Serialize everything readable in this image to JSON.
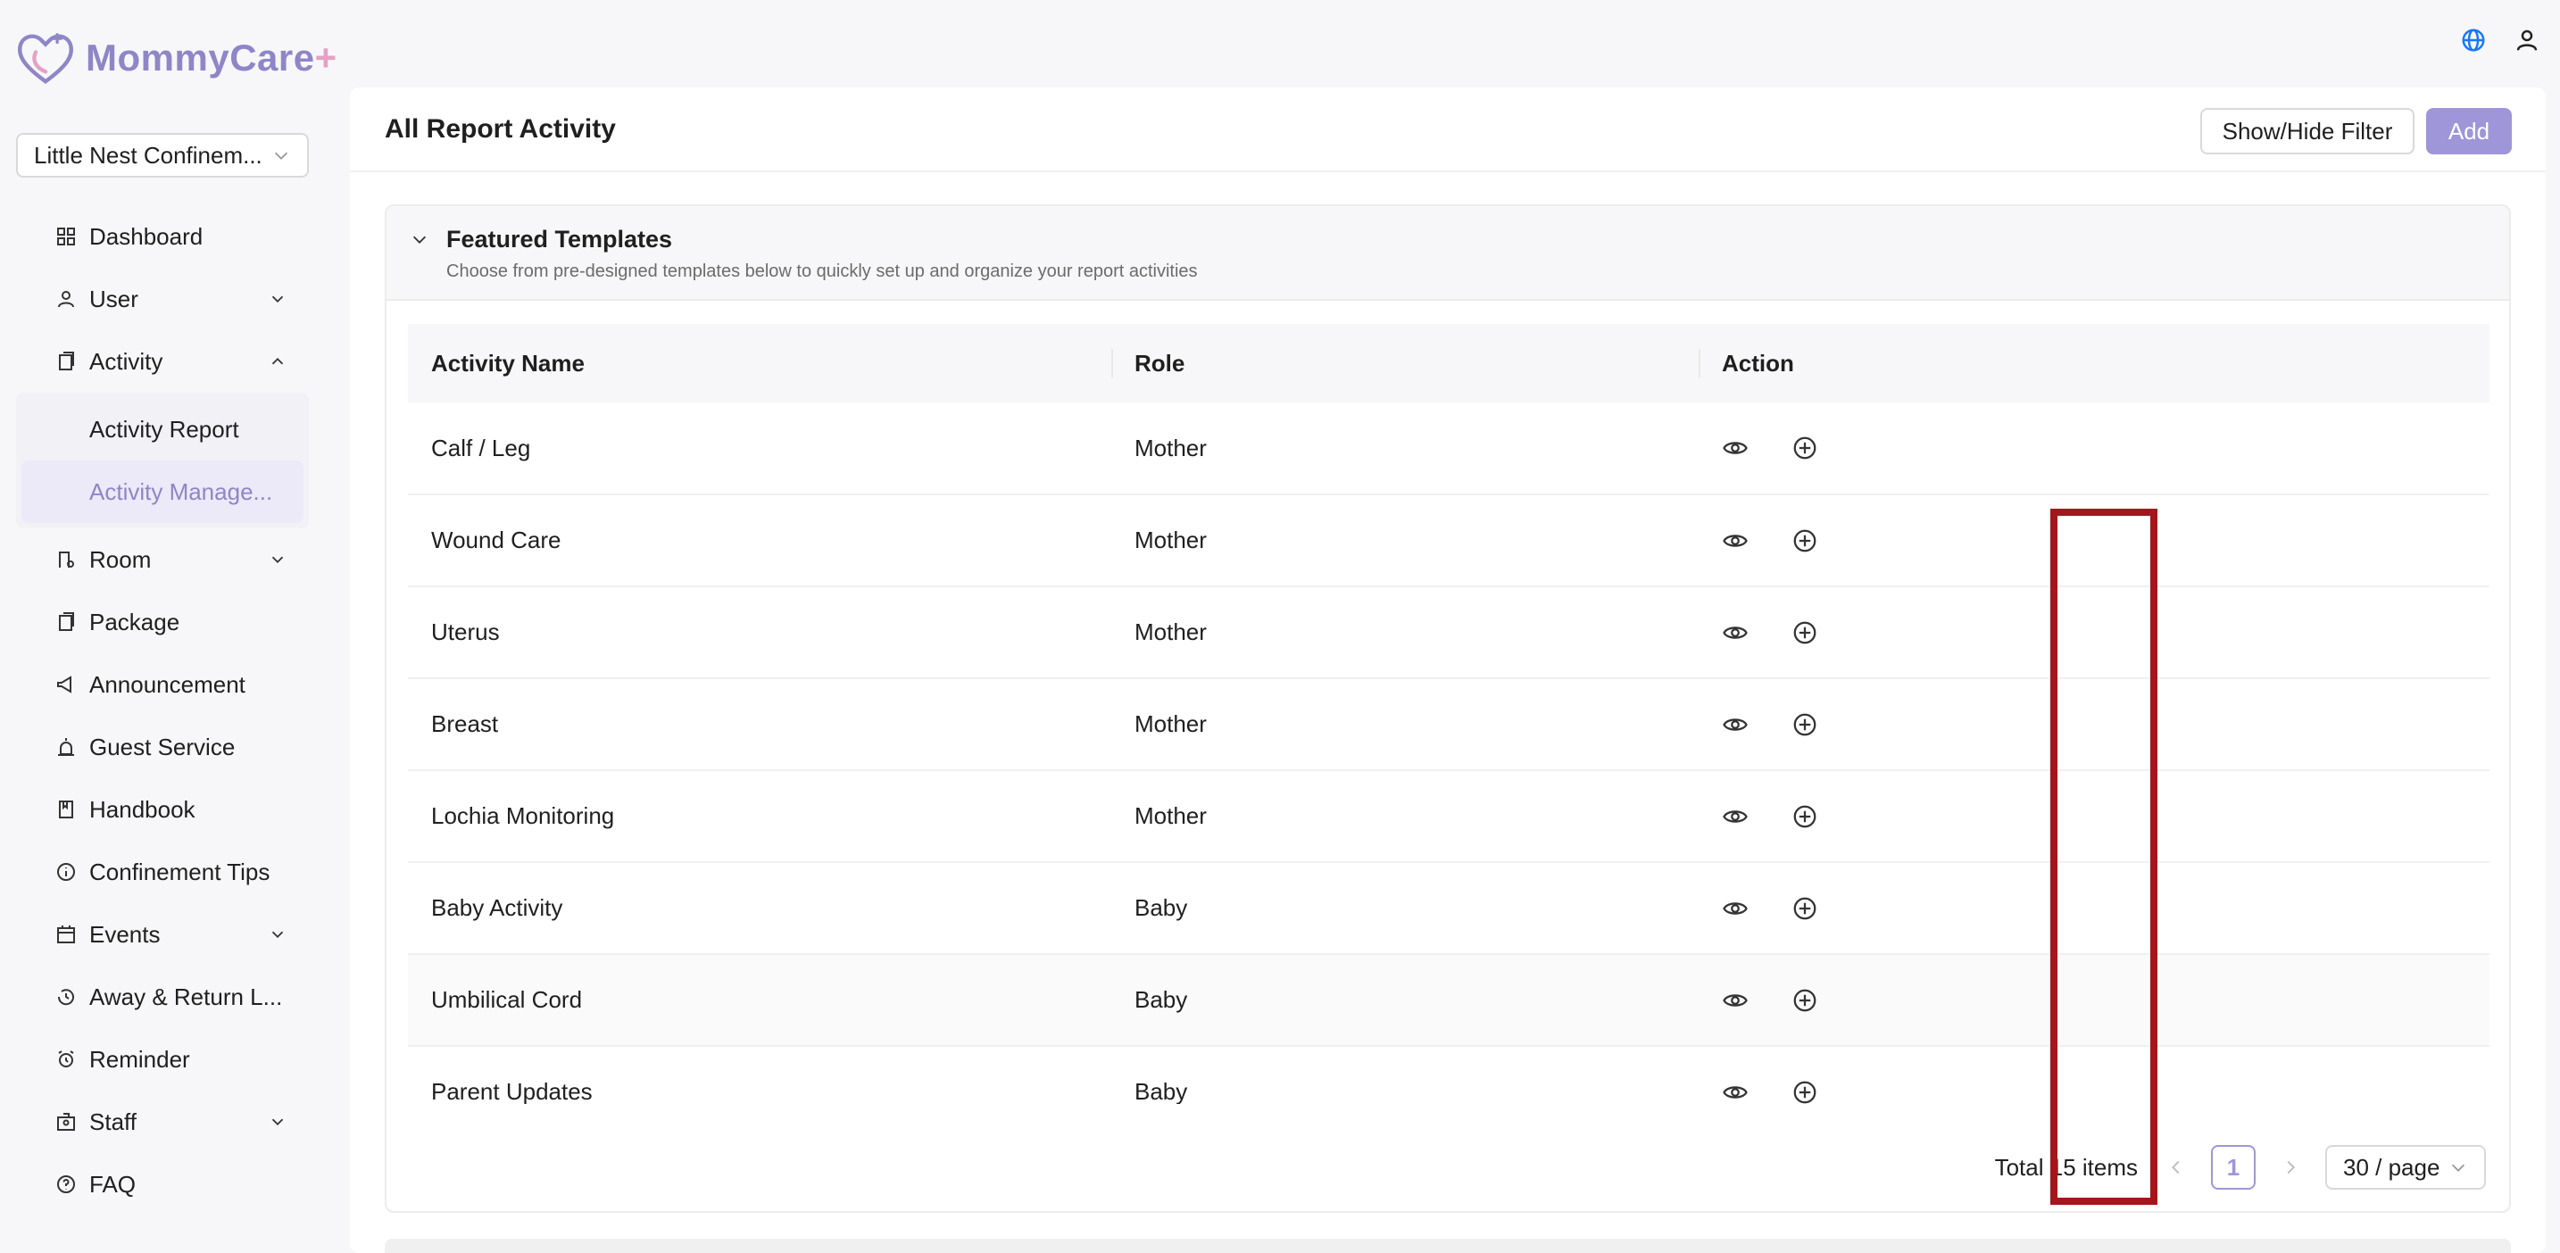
{
  "brand": {
    "name": "MommyCare",
    "plus": "+"
  },
  "org_select": {
    "value": "Little Nest Confinem..."
  },
  "nav": {
    "dashboard": "Dashboard",
    "user": "User",
    "activity": "Activity",
    "activity_report": "Activity Report",
    "activity_management": "Activity Manage...",
    "room": "Room",
    "package": "Package",
    "announcement": "Announcement",
    "guest_service": "Guest Service",
    "handbook": "Handbook",
    "confinement_tips": "Confinement Tips",
    "events": "Events",
    "away_return": "Away & Return L...",
    "reminder": "Reminder",
    "staff": "Staff",
    "faq": "FAQ"
  },
  "page": {
    "title": "All Report Activity",
    "filter_btn": "Show/Hide Filter",
    "add_btn": "Add"
  },
  "featured": {
    "title": "Featured Templates",
    "subtitle": "Choose from pre-designed templates below to quickly set up and organize your report activities"
  },
  "table": {
    "headers": {
      "name": "Activity Name",
      "role": "Role",
      "action": "Action"
    },
    "rows": [
      {
        "name": "Calf / Leg",
        "role": "Mother"
      },
      {
        "name": "Wound Care",
        "role": "Mother"
      },
      {
        "name": "Uterus",
        "role": "Mother"
      },
      {
        "name": "Breast",
        "role": "Mother"
      },
      {
        "name": "Lochia Monitoring",
        "role": "Mother"
      },
      {
        "name": "Baby Activity",
        "role": "Baby"
      },
      {
        "name": "Umbilical Cord",
        "role": "Baby"
      },
      {
        "name": "Parent Updates",
        "role": "Baby"
      }
    ]
  },
  "pagination": {
    "total": "Total 15 items",
    "page": "1",
    "page_size": "30 / page"
  },
  "colors": {
    "accent": "#9e96d8",
    "highlight": "#a3161c"
  }
}
